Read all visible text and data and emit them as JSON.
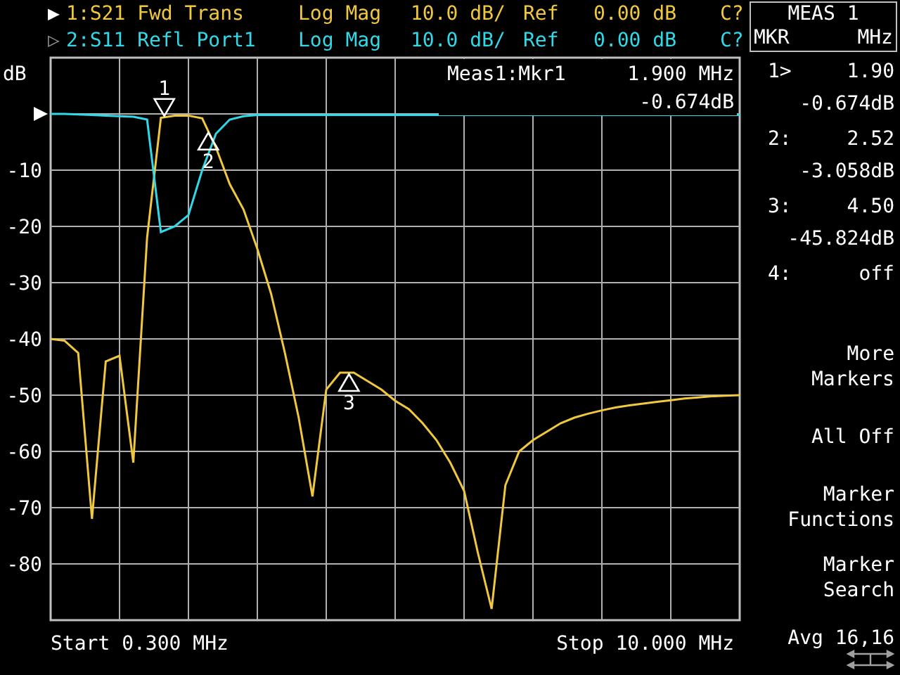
{
  "channels": [
    {
      "marker": "▶",
      "selected": true,
      "format": "Log Mag",
      "scale": "10.0 dB/",
      "ref_label": "Ref",
      "ref_value": "0.00 dB",
      "status": "C?",
      "color": "#f0c840"
    },
    {
      "marker": "▷",
      "selected": false,
      "format": "Log Mag",
      "scale": "10.0 dB/",
      "ref_label": "Ref",
      "ref_value": "0.00 dB",
      "status": "C?",
      "color": "#30d8e8"
    }
  ],
  "menu_header": {
    "title": "MEAS 1",
    "left": "MKR",
    "right": "MHz"
  },
  "readout": {
    "title": "Meas1:Mkr1",
    "frequency": "1.900 MHz",
    "value": "-0.674dB"
  },
  "chart_data": {
    "type": "line",
    "ylabel": "dB",
    "grid": true,
    "ylim": [
      -90,
      10
    ],
    "yticks": [
      {
        "value": -10,
        "label": "-10"
      },
      {
        "value": -20,
        "label": "-20"
      },
      {
        "value": -30,
        "label": "-30"
      },
      {
        "value": -40,
        "label": "-40"
      },
      {
        "value": -50,
        "label": "-50"
      },
      {
        "value": -60,
        "label": "-60"
      },
      {
        "value": -70,
        "label": "-70"
      },
      {
        "value": -80,
        "label": "-80"
      }
    ],
    "categories": [
      null,
      null,
      null,
      null,
      null,
      null,
      null,
      null,
      null,
      null,
      null,
      null,
      null,
      null,
      null,
      null,
      null,
      null,
      null,
      null,
      null,
      null,
      null,
      null,
      null,
      null,
      null,
      null,
      null,
      null,
      null,
      null,
      null,
      null,
      null,
      null,
      null,
      null,
      null,
      null,
      null,
      null,
      null,
      null,
      null,
      null,
      null,
      null,
      null,
      null,
      null
    ],
    "series": [
      {
        "name": "1:S21 Fwd Trans",
        "color": "#f0c840",
        "values": [
          -40,
          -40.3,
          -42.5,
          -72,
          -44,
          -43,
          -62,
          -22,
          -0.7,
          -0.3,
          -0.3,
          -0.8,
          -6,
          -12.5,
          -17,
          -24,
          -32,
          -42.5,
          -54,
          -68,
          -49,
          -46,
          -46,
          -47.5,
          -49,
          -51,
          -52.5,
          -55,
          -58,
          -62,
          -67,
          -78,
          -88,
          -66,
          -60,
          -58,
          -56.5,
          -55,
          -54,
          -53.3,
          -52.7,
          -52.2,
          -51.8,
          -51.5,
          -51.2,
          -50.9,
          -50.6,
          -50.4,
          -50.2,
          -50.1,
          -50
        ]
      },
      {
        "name": "2:S11 Refl Port1",
        "color": "#30d8e8",
        "values": [
          0,
          0,
          -0.1,
          -0.2,
          -0.3,
          -0.4,
          -0.5,
          -1,
          -21,
          -20,
          -18,
          -10,
          -3.5,
          -1,
          -0.4,
          -0.2,
          -0.2,
          -0.2,
          -0.2,
          -0.2,
          -0.2,
          -0.2,
          -0.2,
          -0.2,
          -0.2,
          -0.2,
          -0.2,
          -0.2,
          -0.2,
          -0.2,
          -0.2,
          -0.2,
          -0.2,
          -0.2,
          -0.2,
          -0.2,
          -0.2,
          -0.2,
          -0.2,
          -0.2,
          -0.2,
          -0.2,
          -0.2,
          -0.2,
          -0.2,
          -0.2,
          -0.2,
          -0.2,
          -0.2,
          -0.2,
          -0.2
        ]
      }
    ],
    "annotations": [
      "1",
      "2",
      "3"
    ]
  },
  "markers": [
    {
      "label": "1>",
      "value": "1.90",
      "reading": "-0.674dB"
    },
    {
      "label": "2:",
      "value": "2.52",
      "reading": "-3.058dB"
    },
    {
      "label": "3:",
      "value": "4.50",
      "reading": "-45.824dB"
    },
    {
      "label": "4:",
      "value": "off"
    }
  ],
  "softkeys": [
    {
      "lines": [
        "More",
        "Markers"
      ]
    },
    {
      "lines": [
        "All Off"
      ]
    },
    {
      "lines": [
        "Marker",
        "Functions"
      ]
    },
    {
      "lines": [
        "Marker",
        "Search"
      ]
    }
  ],
  "footer": {
    "start": "Start 0.300 MHz",
    "stop": "Stop 10.000 MHz",
    "averaging": "Avg 16,16"
  }
}
